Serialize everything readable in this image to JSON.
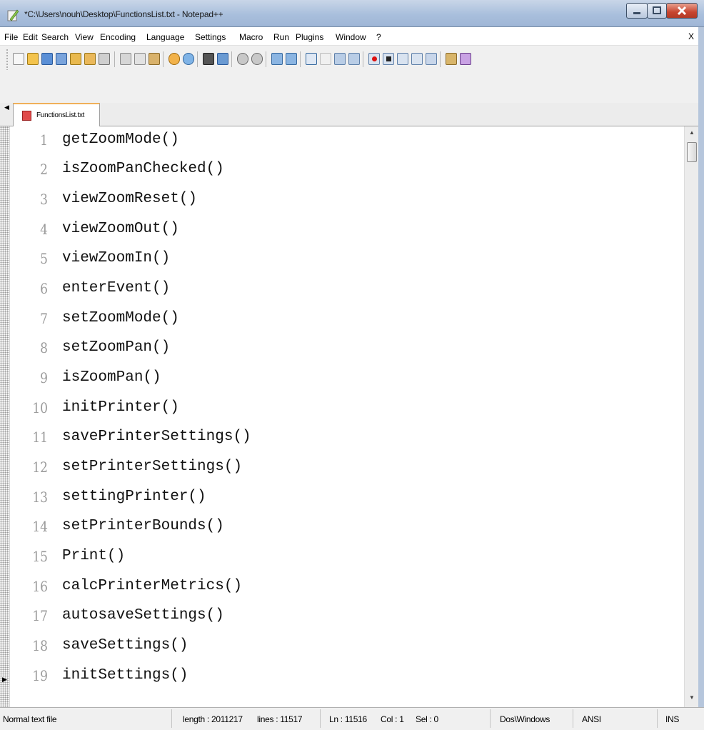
{
  "window": {
    "title": "*C:\\Users\\nouh\\Desktop\\FunctionsList.txt - Notepad++"
  },
  "menu": {
    "items": [
      "File",
      "Edit",
      "Search",
      "View",
      "Encoding",
      "Language",
      "Settings",
      "Macro",
      "Run",
      "Plugins",
      "Window",
      "?"
    ],
    "close": "X"
  },
  "toolbar": {
    "icons": [
      "new-file-icon",
      "open-file-icon",
      "save-icon",
      "save-all-icon",
      "close-icon",
      "close-all-icon",
      "print-icon",
      "cut-icon",
      "copy-icon",
      "paste-icon",
      "undo-icon",
      "redo-icon",
      "find-icon",
      "replace-icon",
      "zoom-in-icon",
      "zoom-out-icon",
      "sync-vertical-icon",
      "sync-horizontal-icon",
      "word-wrap-icon",
      "show-all-chars-icon",
      "indent-guide-icon",
      "doc-map-icon",
      "record-macro-icon",
      "stop-record-icon",
      "playback-icon",
      "run-macro-multiple-icon",
      "save-macro-icon",
      "spellcheck-icon",
      "abc-spell-icon"
    ]
  },
  "tab": {
    "label": "FunctionsList.txt"
  },
  "editor": {
    "lines": [
      {
        "num": "1",
        "text": "getZoomMode()"
      },
      {
        "num": "2",
        "text": "isZoomPanChecked()"
      },
      {
        "num": "3",
        "text": "viewZoomReset()"
      },
      {
        "num": "4",
        "text": "viewZoomOut()"
      },
      {
        "num": "5",
        "text": "viewZoomIn()"
      },
      {
        "num": "6",
        "text": "enterEvent()"
      },
      {
        "num": "7",
        "text": "setZoomMode()"
      },
      {
        "num": "8",
        "text": "setZoomPan()"
      },
      {
        "num": "9",
        "text": "isZoomPan()"
      },
      {
        "num": "10",
        "text": "initPrinter()"
      },
      {
        "num": "11",
        "text": "savePrinterSettings()"
      },
      {
        "num": "12",
        "text": "setPrinterSettings()"
      },
      {
        "num": "13",
        "text": "settingPrinter()"
      },
      {
        "num": "14",
        "text": "setPrinterBounds()"
      },
      {
        "num": "15",
        "text": "Print()"
      },
      {
        "num": "16",
        "text": "calcPrinterMetrics()"
      },
      {
        "num": "17",
        "text": "autosaveSettings()"
      },
      {
        "num": "18",
        "text": "saveSettings()"
      },
      {
        "num": "19",
        "text": "initSettings()"
      }
    ]
  },
  "status": {
    "file_type": "Normal text file",
    "length": "length : 2011217",
    "lines": "lines : 11517",
    "ln": "Ln : 11516",
    "col": "Col : 1",
    "sel": "Sel : 0",
    "eol": "Dos\\Windows",
    "encoding": "ANSI",
    "mode": "INS"
  },
  "colors": {
    "titlebar": "#a9bfdc",
    "line_number": "#9a9a9a",
    "tab_accent": "#f0b05a",
    "close_button": "#c7452f"
  }
}
